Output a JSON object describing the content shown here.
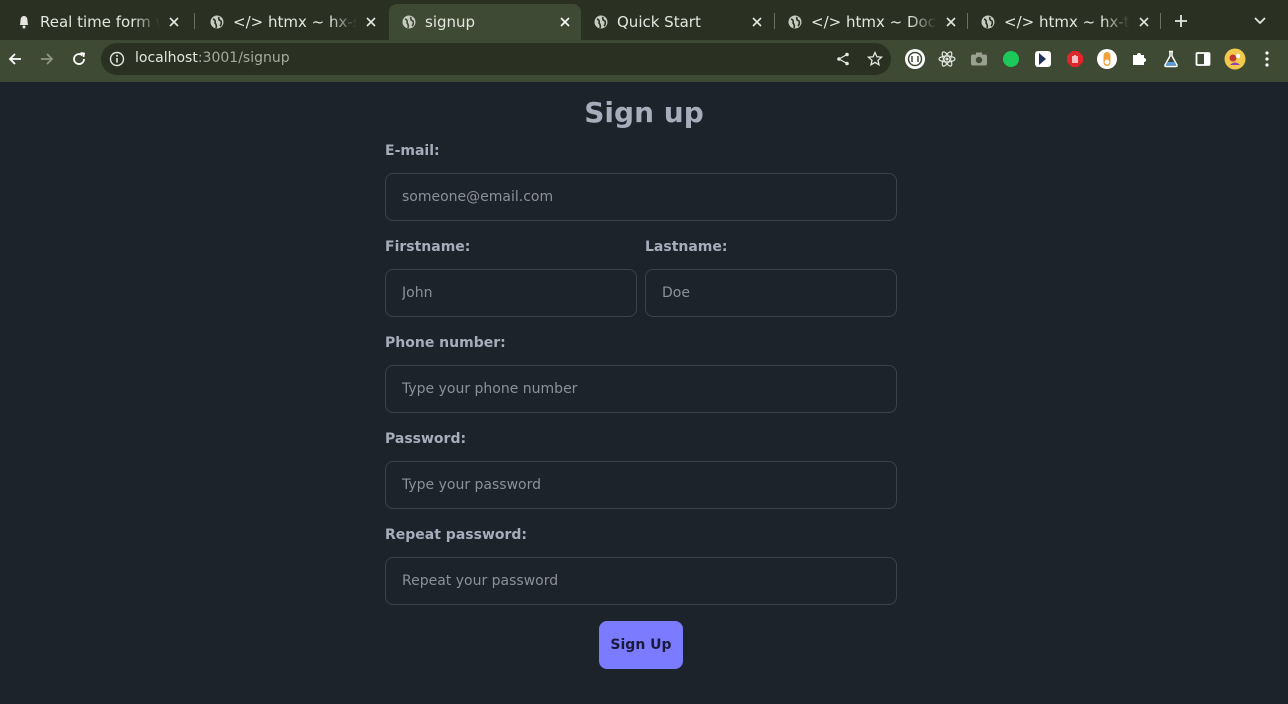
{
  "browser": {
    "tabs": [
      {
        "title": "Real time form val",
        "favicon": "bell-icon",
        "active": false
      },
      {
        "title": "</> htmx ~ hx-swa",
        "favicon": "globe-icon",
        "active": false
      },
      {
        "title": "signup",
        "favicon": "globe-icon",
        "active": true
      },
      {
        "title": "Quick Start",
        "favicon": "globe-icon",
        "active": false
      },
      {
        "title": "</> htmx ~ Docum",
        "favicon": "globe-icon",
        "active": false
      },
      {
        "title": "</> htmx ~ hx-trig",
        "favicon": "globe-icon",
        "active": false
      }
    ],
    "url_host": "localhost",
    "url_path": ":3001/signup",
    "extensions": [
      "ublock-icon",
      "react-devtools-icon",
      "camera-icon",
      "green-dot-icon",
      "dark-reader-icon",
      "hand-stop-icon",
      "toggle-icon",
      "puzzle-icon",
      "flask-icon",
      "sidebar-icon",
      "avatar"
    ]
  },
  "form": {
    "title": "Sign up",
    "email_label": "E-mail:",
    "email_placeholder": "someone@email.com",
    "firstname_label": "Firstname:",
    "firstname_placeholder": "John",
    "lastname_label": "Lastname:",
    "lastname_placeholder": "Doe",
    "phone_label": "Phone number:",
    "phone_placeholder": "Type your phone number",
    "password_label": "Password:",
    "password_placeholder": "Type your password",
    "repeat_label": "Repeat password:",
    "repeat_placeholder": "Repeat your password",
    "submit_label": "Sign Up"
  },
  "colors": {
    "page_bg": "#1d232a",
    "text": "#a6adbb",
    "primary": "#7b7bff",
    "chrome_frame": "#2a3122",
    "chrome_toolbar": "#3f4a34"
  }
}
